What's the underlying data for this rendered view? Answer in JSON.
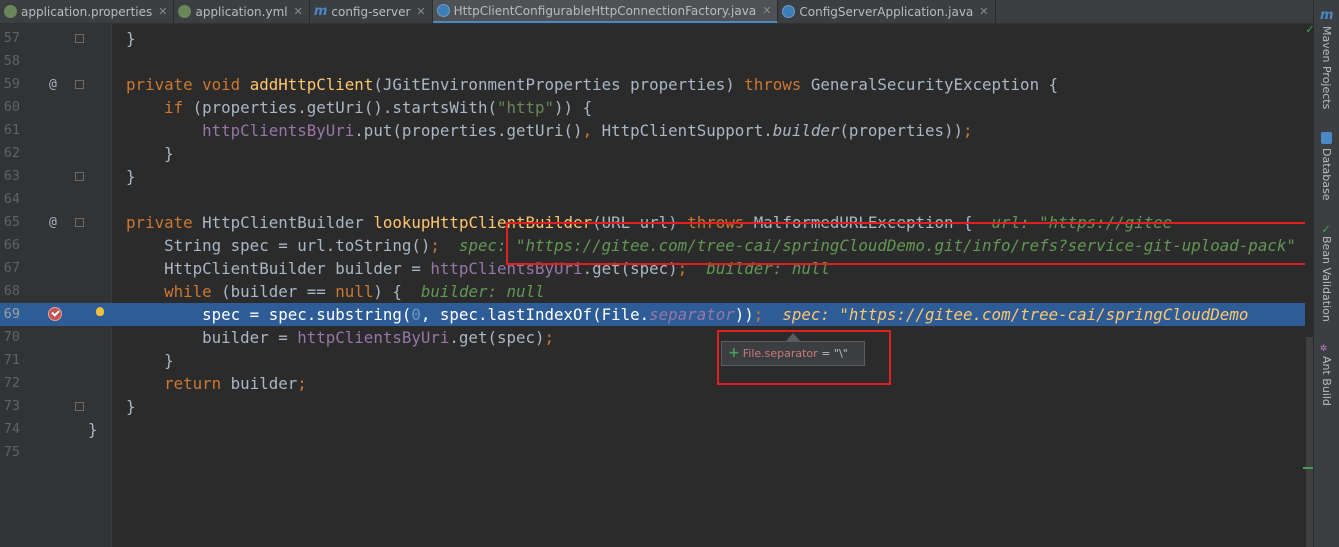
{
  "tabs": [
    {
      "label": "application.properties"
    },
    {
      "label": "application.yml"
    },
    {
      "label": "config-server"
    },
    {
      "label": "HttpClientConfigurableHttpConnectionFactory.java"
    },
    {
      "label": "ConfigServerApplication.java"
    }
  ],
  "right_panel": {
    "maven": "Maven Projects",
    "database": "Database",
    "bean": "Bean Validation",
    "ant": "Ant Build"
  },
  "editor": {
    "lines": {
      "57": "57",
      "58": "58",
      "59": "59",
      "60": "60",
      "61": "61",
      "62": "62",
      "63": "63",
      "64": "64",
      "65": "65",
      "66": "66",
      "67": "67",
      "68": "68",
      "69": "69",
      "70": "70",
      "71": "71",
      "72": "72",
      "73": "73",
      "74": "74",
      "75": "75"
    },
    "code": {
      "l57": "    }",
      "l59_a": "    ",
      "l59_kw": "private void ",
      "l59_fn": "addHttpClient",
      "l59_b": "(JGitEnvironmentProperties properties) ",
      "l59_kw2": "throws ",
      "l59_c": "GeneralSecurityException {",
      "l60_kw": "        if ",
      "l60_a": "(properties.getUri().startsWith(",
      "l60_str": "\"http\"",
      "l60_b": ")) {",
      "l61_fld": "            httpClientsByUri",
      "l61_a": ".put(properties.getUri()",
      "l61_comma": ", ",
      "l61_b": "HttpClientSupport.",
      "l61_it": "builder",
      "l61_c": "(properties))",
      "l61_semi": ";",
      "l62": "        }",
      "l63": "    }",
      "l65_kw": "    private ",
      "l65_a": "HttpClientBuilder ",
      "l65_fn": "lookupHttpClientBuilder",
      "l65_b": "(URL url) ",
      "l65_kw2": "throws ",
      "l65_c": "MalformedURLException {  ",
      "l65_hint": "url: \"https://gitee",
      "l66_a": "        String spec = url.toString()",
      "l66_semi": ";  ",
      "l66_hint": "spec: \"https://gitee.com/tree-cai/springCloudDemo.git/info/refs?service-git-upload-pack\"",
      "l67_a": "        HttpClientBuilder builder = ",
      "l67_fld": "httpClientsByUri",
      "l67_b": ".get(spec)",
      "l67_semi": ";  ",
      "l67_hint": "builder: null",
      "l68_kw": "        while ",
      "l68_a": "(builder == ",
      "l68_kw2": "null",
      "l68_b": ") {  ",
      "l68_hint": "builder: null",
      "l69_a": "            spec = spec.substring(",
      "l69_num": "0",
      "l69_b": ", spec.lastIndexOf(File.",
      "l69_fld": "separator",
      "l69_c": "))",
      "l69_semi": ";  ",
      "l69_hint": "spec: \"https://gitee.com/tree-cai/springCloudDemo",
      "l70_a": "            builder = ",
      "l70_fld": "httpClientsByUri",
      "l70_b": ".get(spec)",
      "l70_semi": ";",
      "l71": "        }",
      "l72_kw": "        return ",
      "l72_a": "builder",
      "l72_semi": ";",
      "l73": "    }",
      "l74": "}"
    }
  },
  "tooltip": {
    "plus": "+",
    "name": "File.separator",
    "eq": " = ",
    "value": "\"\\\""
  },
  "colors": {
    "accent": "#4a88c7",
    "highlight": "#2d5c96",
    "annotation": "#e02020"
  }
}
